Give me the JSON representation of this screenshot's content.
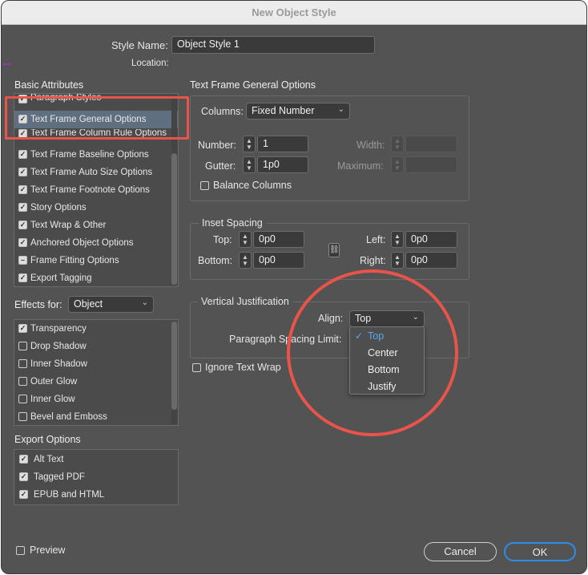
{
  "window": {
    "title": "New Object Style"
  },
  "header": {
    "style_name_label": "Style Name:",
    "style_name_value": "Object Style 1",
    "location_label": "Location:"
  },
  "basic_attributes": {
    "title": "Basic Attributes",
    "items": [
      {
        "label": "Paragraph Styles",
        "checked": true
      },
      {
        "label": "Text Frame General Options",
        "checked": true,
        "selected": true
      },
      {
        "label": "Text Frame Column Rule Options",
        "checked": true
      },
      {
        "label": "Text Frame Baseline Options",
        "checked": true
      },
      {
        "label": "Text Frame Auto Size Options",
        "checked": true
      },
      {
        "label": "Text Frame Footnote Options",
        "checked": true
      },
      {
        "label": "Story Options",
        "checked": true
      },
      {
        "label": "Text Wrap & Other",
        "checked": true
      },
      {
        "label": "Anchored Object Options",
        "checked": true
      },
      {
        "label": "Frame Fitting Options",
        "checked": "mixed"
      },
      {
        "label": "Export Tagging",
        "checked": true
      }
    ]
  },
  "effects": {
    "label": "Effects for:",
    "selected": "Object",
    "items": [
      {
        "label": "Transparency",
        "checked": true
      },
      {
        "label": "Drop Shadow",
        "checked": false
      },
      {
        "label": "Inner Shadow",
        "checked": false
      },
      {
        "label": "Outer Glow",
        "checked": false
      },
      {
        "label": "Inner Glow",
        "checked": false
      },
      {
        "label": "Bevel and Emboss",
        "checked": false
      }
    ]
  },
  "export_options": {
    "title": "Export Options",
    "items": [
      {
        "label": "Alt Text",
        "checked": true
      },
      {
        "label": "Tagged PDF",
        "checked": true
      },
      {
        "label": "EPUB and HTML",
        "checked": true
      }
    ]
  },
  "panel": {
    "title": "Text Frame General Options",
    "columns_label": "Columns:",
    "columns_value": "Fixed Number",
    "number_label": "Number:",
    "number_value": "1",
    "gutter_label": "Gutter:",
    "gutter_value": "1p0",
    "width_label": "Width:",
    "maximum_label": "Maximum:",
    "balance_label": "Balance Columns",
    "inset_title": "Inset Spacing",
    "top_label": "Top:",
    "top_value": "0p0",
    "bottom_label": "Bottom:",
    "bottom_value": "0p0",
    "left_label": "Left:",
    "left_value": "0p0",
    "right_label": "Right:",
    "right_value": "0p0",
    "vj_title": "Vertical Justification",
    "align_label": "Align:",
    "align_value": "Top",
    "psl_label": "Paragraph Spacing Limit:",
    "ignore_wrap_label": "Ignore Text Wrap"
  },
  "align_menu": {
    "options": [
      "Top",
      "Center",
      "Bottom",
      "Justify"
    ],
    "checked": "Top"
  },
  "footer": {
    "preview_label": "Preview",
    "cancel_label": "Cancel",
    "ok_label": "OK"
  },
  "colors": {
    "dialog_bg": "#535353",
    "highlight": "#e8544a",
    "accent": "#2d8ceb",
    "menu_checked": "#5aa8f0"
  }
}
